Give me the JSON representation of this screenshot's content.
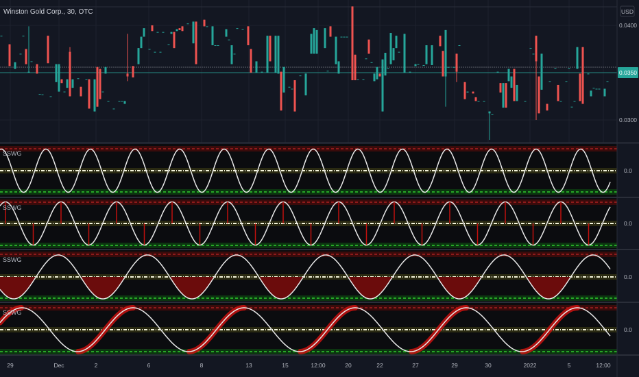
{
  "header": {
    "symbol_title": "Winston Gold Corp., 30, OTC",
    "currency": "USD"
  },
  "price_axis": {
    "ticks": [
      "0.0400",
      "0.0300"
    ],
    "last_price": "0.0350"
  },
  "indicator_label": "SSWG",
  "indicator_value_label": "0.0",
  "time_axis": {
    "labels": [
      "29",
      "Dec",
      "2",
      "6",
      "8",
      "13",
      "15",
      "12:00",
      "20",
      "22",
      "27",
      "29",
      "30",
      "2022",
      "5",
      "12:00"
    ]
  },
  "colors": {
    "up": "#26a69a",
    "down": "#ef5350",
    "background": "#131722",
    "pane_bg": "#0b0c0f",
    "upper_band": "#e02b2b",
    "lower_band": "#2ecc2e",
    "mid_band": "#f5f5dc",
    "wave": "#e8e8e8",
    "last_price_bg": "#26a69a"
  },
  "chart_data": [
    {
      "type": "candlestick",
      "title": "Winston Gold Corp., 30, OTC",
      "ylim": [
        0.0275,
        0.0425
      ],
      "last_price": 0.035,
      "candles_format": [
        "bar",
        "open",
        "close",
        "high",
        "low"
      ],
      "candles": [
        [
          0,
          0.0389,
          0.0389
        ],
        [
          3,
          0.038,
          0.0357
        ],
        [
          5,
          0.0354,
          0.0361
        ],
        [
          7,
          0.037,
          0.037
        ],
        [
          8,
          0.0389,
          0.0389
        ],
        [
          9,
          0.0375,
          0.0359
        ],
        [
          10,
          0.035,
          0.0351,
          0.0399,
          0.035
        ],
        [
          11,
          0.0362,
          0.0362
        ],
        [
          13,
          0.0359,
          0.0349
        ],
        [
          14,
          0.03275,
          0.03275
        ],
        [
          15,
          0.0327,
          0.0327
        ],
        [
          17,
          0.0389,
          0.036
        ],
        [
          18,
          0.0325,
          0.0325
        ],
        [
          20,
          0.034,
          0.0359
        ],
        [
          21,
          0.033,
          0.0359
        ],
        [
          22,
          0.0343,
          0.0339
        ],
        [
          23,
          0.033,
          0.033
        ],
        [
          24,
          0.0334,
          0.0343
        ],
        [
          25,
          0.0372,
          0.0325,
          0.0377,
          0.0325
        ],
        [
          26,
          0.0334,
          0.0343
        ],
        [
          28,
          0.0344,
          0.0344
        ],
        [
          29,
          0.0335,
          0.0325
        ],
        [
          31,
          0.0343,
          0.0343
        ],
        [
          32,
          0.0343,
          0.0312
        ],
        [
          34,
          0.0309,
          0.0343
        ],
        [
          35,
          0.0356,
          0.0314
        ],
        [
          36,
          0.0354,
          0.0322
        ],
        [
          37,
          0.033,
          0.033
        ],
        [
          38,
          0.0349,
          0.0356
        ],
        [
          39,
          0.032,
          0.032
        ],
        [
          41,
          0.0312,
          0.0312
        ],
        [
          43,
          0.032,
          0.032
        ],
        [
          44,
          0.032,
          0.032
        ],
        [
          45,
          0.0317,
          0.032
        ],
        [
          46,
          0.0349,
          0.0346,
          0.0391,
          0.0341
        ],
        [
          48,
          0.0357,
          0.0345
        ],
        [
          50,
          0.0359,
          0.0376
        ],
        [
          51,
          0.0376,
          0.0388
        ],
        [
          52,
          0.0388,
          0.0397
        ],
        [
          54,
          0.0375,
          0.0375
        ],
        [
          55,
          0.04,
          0.0394
        ],
        [
          56,
          0.0372,
          0.0372
        ],
        [
          57,
          0.0393,
          0.0393
        ],
        [
          58,
          0.0372,
          0.0372
        ],
        [
          59,
          0.0393,
          0.0393
        ],
        [
          61,
          0.038,
          0.038
        ],
        [
          62,
          0.0391,
          0.0393
        ],
        [
          63,
          0.0393,
          0.0376
        ],
        [
          64,
          0.0394,
          0.0396
        ],
        [
          65,
          0.0397,
          0.0395
        ],
        [
          66,
          0.0399,
          0.0394
        ],
        [
          68,
          0.0402,
          0.0402
        ],
        [
          70,
          0.0381,
          0.0404
        ],
        [
          71,
          0.0404,
          0.0359
        ],
        [
          74,
          0.0406,
          0.0399
        ],
        [
          75,
          0.0399,
          0.0399
        ],
        [
          77,
          0.0379,
          0.0399
        ],
        [
          78,
          0.0379,
          0.0379
        ],
        [
          79,
          0.0379,
          0.0379
        ],
        [
          82,
          0.0388,
          0.0396
        ],
        [
          83,
          0.0385,
          0.0385
        ],
        [
          84,
          0.0359,
          0.0379
        ],
        [
          85,
          0.037,
          0.037
        ],
        [
          86,
          0.0397,
          0.0397
        ],
        [
          88,
          0.0396,
          0.0396
        ],
        [
          90,
          0.0399,
          0.0379
        ],
        [
          91,
          0.0375,
          0.035
        ],
        [
          93,
          0.035,
          0.0362
        ],
        [
          95,
          0.0351,
          0.0351
        ],
        [
          97,
          0.035,
          0.0389
        ],
        [
          98,
          0.0389,
          0.0362
        ],
        [
          100,
          0.035,
          0.0389
        ],
        [
          101,
          0.0349,
          0.0389
        ],
        [
          102,
          0.0351,
          0.031
        ],
        [
          103,
          0.0329,
          0.0356
        ],
        [
          105,
          0.0335,
          0.0335
        ],
        [
          106,
          0.0333,
          0.0333
        ],
        [
          107,
          0.0342,
          0.0309
        ],
        [
          109,
          0.0347,
          0.0347
        ],
        [
          111,
          0.0326,
          0.0349
        ],
        [
          113,
          0.037,
          0.0391
        ],
        [
          114,
          0.037,
          0.0397
        ],
        [
          115,
          0.037,
          0.0395
        ],
        [
          118,
          0.0376,
          0.0397
        ],
        [
          119,
          0.0352,
          0.0352
        ],
        [
          120,
          0.0399,
          0.0388
        ],
        [
          122,
          0.0359,
          0.0388
        ],
        [
          123,
          0.0349,
          0.0362
        ],
        [
          124,
          0.0388,
          0.0388
        ],
        [
          125,
          0.0388,
          0.0388
        ],
        [
          126,
          0.0388,
          0.0388
        ],
        [
          128,
          0.042,
          0.0342
        ],
        [
          129,
          0.0369,
          0.0342
        ],
        [
          130,
          0.0343,
          0.0343
        ],
        [
          132,
          0.0343,
          0.0343
        ],
        [
          133,
          0.0365,
          0.0365
        ],
        [
          134,
          0.0385,
          0.037
        ],
        [
          135,
          0.0361,
          0.0361
        ],
        [
          136,
          0.0341,
          0.0349
        ],
        [
          137,
          0.0343,
          0.0356
        ],
        [
          138,
          0.0349,
          0.0346
        ],
        [
          139,
          0.0309,
          0.0364
        ],
        [
          140,
          0.0347,
          0.0371
        ],
        [
          141,
          0.0355,
          0.0355
        ],
        [
          142,
          0.0359,
          0.0392
        ],
        [
          143,
          0.0363,
          0.0376
        ],
        [
          144,
          0.0376,
          0.0389
        ],
        [
          145,
          0.0372,
          0.0372
        ],
        [
          147,
          0.035,
          0.0391
        ],
        [
          149,
          0.0351,
          0.0351
        ],
        [
          151,
          0.0357,
          0.0359
        ],
        [
          152,
          0.0359,
          0.0359
        ],
        [
          154,
          0.0358,
          0.0358
        ],
        [
          155,
          0.0359,
          0.0379
        ],
        [
          157,
          0.0358,
          0.0379
        ],
        [
          160,
          0.0389,
          0.0378
        ],
        [
          161,
          0.0373,
          0.0346
        ],
        [
          162,
          0.0346,
          0.0395,
          0.0395,
          0.0314
        ],
        [
          163,
          0.0356,
          0.0356
        ],
        [
          165,
          0.0356,
          0.0356
        ],
        [
          166,
          0.037,
          0.0351,
          0.037,
          0.034
        ],
        [
          167,
          0.0379,
          0.0379
        ],
        [
          169,
          0.034,
          0.0322
        ],
        [
          170,
          0.0329,
          0.033
        ],
        [
          172,
          0.033,
          0.0328
        ],
        [
          173,
          0.0324,
          0.032
        ],
        [
          174,
          0.032,
          0.032
        ],
        [
          176,
          0.032,
          0.032
        ],
        [
          178,
          0.0307,
          0.0309,
          0.0309,
          0.0279
        ],
        [
          179,
          0.0306,
          0.0306
        ],
        [
          181,
          0.0351,
          0.0351
        ],
        [
          182,
          0.0339,
          0.0329
        ],
        [
          183,
          0.0313,
          0.0339
        ],
        [
          184,
          0.0339,
          0.0313
        ],
        [
          185,
          0.0341,
          0.0354
        ],
        [
          186,
          0.0334,
          0.0346
        ],
        [
          187,
          0.0354,
          0.032
        ],
        [
          188,
          0.032,
          0.0337
        ],
        [
          191,
          0.032,
          0.032
        ],
        [
          193,
          0.0376,
          0.0376
        ],
        [
          194,
          0.037,
          0.037
        ],
        [
          195,
          0.0389,
          0.0362,
          0.0389,
          0.03
        ],
        [
          196,
          0.0346,
          0.0307
        ],
        [
          197,
          0.0332,
          0.037
        ],
        [
          199,
          0.0317,
          0.031
        ],
        [
          200,
          0.0341,
          0.0341
        ],
        [
          202,
          0.0355,
          0.0355
        ],
        [
          203,
          0.0337,
          0.032
        ],
        [
          204,
          0.032,
          0.032
        ],
        [
          206,
          0.0341,
          0.0341
        ],
        [
          207,
          0.0355,
          0.0355
        ],
        [
          208,
          0.0314,
          0.0314
        ],
        [
          209,
          0.032,
          0.032
        ],
        [
          210,
          0.0354,
          0.0377
        ],
        [
          211,
          0.0349,
          0.032
        ],
        [
          212,
          0.0377,
          0.0317
        ],
        [
          214,
          0.0349,
          0.0349
        ],
        [
          215,
          0.0325,
          0.0331
        ],
        [
          216,
          0.0334,
          0.0334
        ],
        [
          217,
          0.0333,
          0.0333
        ],
        [
          218,
          0.0333,
          0.0333
        ],
        [
          220,
          0.0325,
          0.0333
        ],
        [
          221,
          0.0341,
          0.0341
        ]
      ]
    },
    {
      "type": "line",
      "name": "SSWG",
      "style": "plain",
      "period_bars": 16.25,
      "peak_bar": 0,
      "ylim": [
        -1,
        1
      ],
      "levels": [
        1,
        0,
        -1
      ]
    },
    {
      "type": "line",
      "name": "SSWG",
      "style": "stems",
      "period_bars": 20.25,
      "peak_bar": 1.5,
      "ylim": [
        -1,
        1
      ],
      "levels": [
        1,
        0,
        -1
      ]
    },
    {
      "type": "line",
      "name": "SSWG",
      "style": "fill-below-zero",
      "period_bars": 32.5,
      "peak_bar": 20.75,
      "ylim": [
        -1,
        1
      ],
      "levels": [
        1,
        0,
        -1
      ]
    },
    {
      "type": "line",
      "name": "SSWG",
      "style": "highlight-rising",
      "period_bars": 40.5,
      "peak_bar": 7.5,
      "ylim": [
        -1,
        1
      ],
      "levels": [
        1,
        0,
        -1
      ]
    }
  ]
}
